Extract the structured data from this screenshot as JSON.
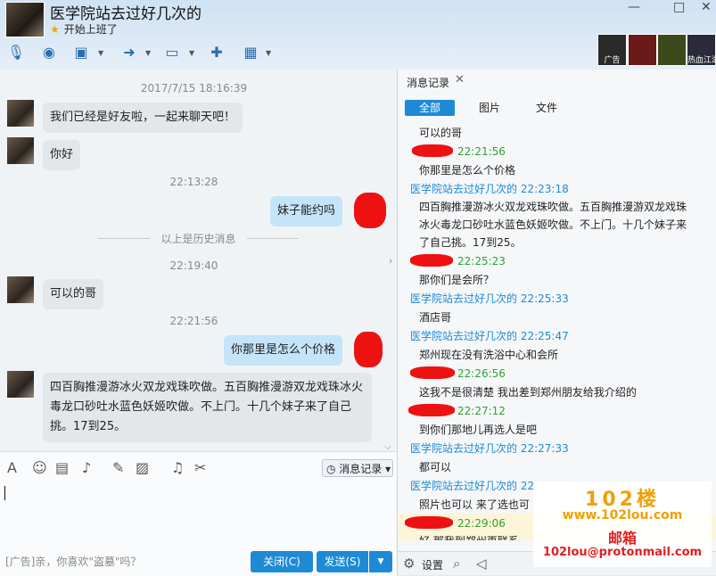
{
  "window": {
    "title": "医学院站去过好几次的",
    "status": "开始上班了",
    "controls": [
      "—",
      "□",
      "✕"
    ]
  },
  "games": [
    {
      "label": "广告"
    },
    {
      "label": ""
    },
    {
      "label": ""
    },
    {
      "label": "热血江湖传"
    }
  ],
  "chat": {
    "messages": [
      {
        "kind": "timestamp",
        "text": "2017/7/15 18:16:39"
      },
      {
        "kind": "received",
        "text": "我们已经是好友啦，一起来聊天吧！"
      },
      {
        "kind": "received",
        "text": "你好"
      },
      {
        "kind": "timestamp",
        "text": "22:13:28"
      },
      {
        "kind": "sent",
        "text": "妹子能约吗"
      },
      {
        "kind": "divider",
        "text": "以上是历史消息"
      },
      {
        "kind": "timestamp",
        "text": "22:19:40"
      },
      {
        "kind": "received",
        "text": "可以的哥"
      },
      {
        "kind": "timestamp",
        "text": "22:21:56"
      },
      {
        "kind": "sent",
        "text": "你那里是怎么个价格"
      },
      {
        "kind": "received",
        "text": "四百胸推漫游冰火双龙戏珠吹做。五百胸推漫游双龙戏珠冰火毒龙口砂吐水蓝色妖姬吹做。不上门。十几个妹子来了自己挑。17到25。"
      }
    ]
  },
  "input": {
    "history_button": "消息记录",
    "ad_text": "[广告]亲，你喜欢\"盗墓\"吗？",
    "close_button": "关闭(C)",
    "send_button": "发送(S)"
  },
  "panel": {
    "tab_label": "消息记录",
    "filters": [
      "全部",
      "图片",
      "文件"
    ],
    "lines": [
      {
        "kind": "txt",
        "text": "可以的哥"
      },
      {
        "kind": "time",
        "text": "22:21:56"
      },
      {
        "kind": "txt",
        "text": "你那里是怎么个价格"
      },
      {
        "kind": "name",
        "text": "医学院站去过好几次的 22:23:18"
      },
      {
        "kind": "para",
        "text": "四百胸推漫游冰火双龙戏珠吹做。五百胸推漫游双龙戏珠冰火毒龙口砂吐水蓝色妖姬吹做。不上门。十几个妹子来了自己挑。17到25。"
      },
      {
        "kind": "time",
        "text": "22:25:23"
      },
      {
        "kind": "txt",
        "text": "那你们是会所？"
      },
      {
        "kind": "name",
        "text": "医学院站去过好几次的 22:25:33"
      },
      {
        "kind": "txt",
        "text": "酒店哥"
      },
      {
        "kind": "name",
        "text": "医学院站去过好几次的 22:25:47"
      },
      {
        "kind": "txt",
        "text": "郑州现在没有洗浴中心和会所"
      },
      {
        "kind": "time",
        "text": "22:26:56"
      },
      {
        "kind": "txt",
        "text": "这我不是很清楚  我出差到郑州朋友给我介绍的"
      },
      {
        "kind": "time",
        "text": "22:27:12"
      },
      {
        "kind": "txt",
        "text": "到你们那地儿再选人是吧"
      },
      {
        "kind": "name",
        "text": "医学院站去过好几次的 22:27:33"
      },
      {
        "kind": "txt",
        "text": "都可以"
      },
      {
        "kind": "name",
        "text": "医学院站去过好几次的 22"
      },
      {
        "kind": "txt",
        "text": "照片也可以 来了选也可"
      },
      {
        "kind": "time",
        "text": "22:29:06"
      },
      {
        "kind": "txt",
        "text": "好  那我到郑州再联系"
      }
    ],
    "footer_settings": "设置"
  },
  "watermark": {
    "brand": "102楼",
    "url": "www.102lou.com",
    "mail_label": "邮箱",
    "mail": "102lou@protonmail.com"
  }
}
